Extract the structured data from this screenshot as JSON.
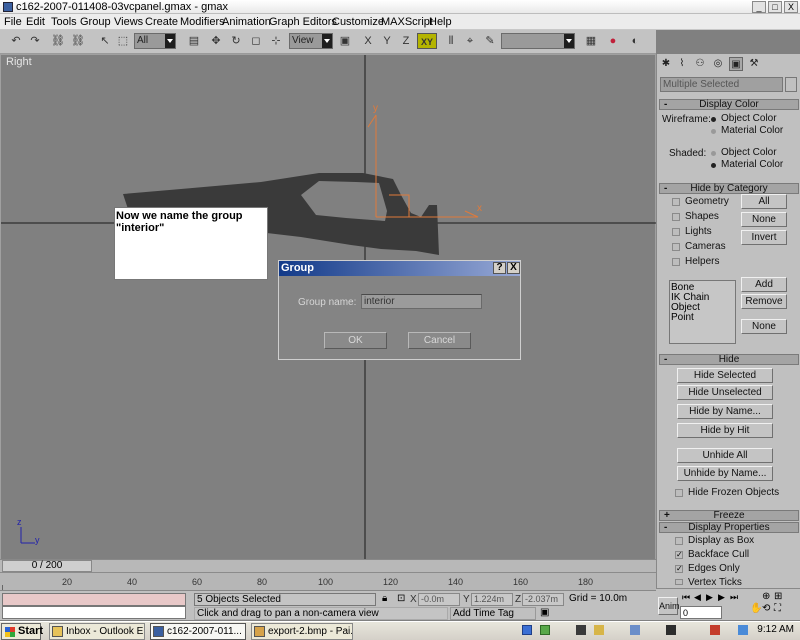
{
  "window": {
    "title": "c162-2007-011408-03vcpanel.gmax - gmax",
    "controls": [
      "_",
      "□",
      "X"
    ]
  },
  "menu": [
    "File",
    "Edit",
    "Tools",
    "Group",
    "Views",
    "Create",
    "Modifiers",
    "Animation",
    "Graph Editors",
    "Customize",
    "MAXScript",
    "Help"
  ],
  "toolbar": {
    "selection_filter": "All",
    "reference_coord": "View",
    "axis_x": "X",
    "axis_y": "Y",
    "axis_z": "Z",
    "axis_xy": "XY"
  },
  "viewport": {
    "label": "Right",
    "annotation": "Now we name the group \"interior\"",
    "gizmo_y": "y",
    "gizmo_x": "x",
    "corner_z": "z",
    "corner_y": "y"
  },
  "dialog": {
    "title": "Group",
    "help_btn": "?",
    "close_btn": "X",
    "name_label": "Group name:",
    "name_value": "interior",
    "ok_label": "OK",
    "cancel_label": "Cancel"
  },
  "cmd_panel": {
    "selection_name": "Multiple Selected",
    "display_color": {
      "header": "Display Color",
      "wireframe_label": "Wireframe:",
      "shaded_label": "Shaded:",
      "object_color": "Object Color",
      "material_color": "Material Color"
    },
    "hide_by_category": {
      "header": "Hide by Category",
      "items": [
        "Geometry",
        "Shapes",
        "Lights",
        "Cameras",
        "Helpers"
      ],
      "all_btn": "All",
      "none_btn": "None",
      "invert_btn": "Invert",
      "list": [
        "Bone",
        "IK Chain Object",
        "Point"
      ],
      "add_btn": "Add",
      "remove_btn": "Remove",
      "none2_btn": "None"
    },
    "hide": {
      "header": "Hide",
      "hide_selected": "Hide Selected",
      "hide_unselected": "Hide Unselected",
      "hide_by_name": "Hide by Name...",
      "hide_by_hit": "Hide by Hit",
      "unhide_all": "Unhide All",
      "unhide_by_name": "Unhide by Name...",
      "hide_frozen": "Hide Frozen Objects"
    },
    "freeze": {
      "header": "Freeze",
      "toggle": "+"
    },
    "display_properties": {
      "header": "Display Properties",
      "toggle": "-",
      "items": [
        {
          "label": "Display as Box",
          "checked": false
        },
        {
          "label": "Backface Cull",
          "checked": true
        },
        {
          "label": "Edges Only",
          "checked": true
        },
        {
          "label": "Vertex Ticks",
          "checked": false
        }
      ]
    }
  },
  "timeline": {
    "slider_label": "0 / 200",
    "ticks": [
      "20",
      "40",
      "60",
      "80",
      "100",
      "120",
      "140",
      "160",
      "180"
    ]
  },
  "status": {
    "selected": "5 Objects Selected",
    "prompt": "Click and drag to pan a non-camera view",
    "x_label": "X",
    "x_value": "-0.0m",
    "y_label": "Y",
    "y_value": "1.224m",
    "z_label": "Z",
    "z_value": "-2.037m",
    "grid": "Grid = 10.0m",
    "add_time_tag": "Add Time Tag",
    "anim": "Anim.",
    "frame": "0"
  },
  "taskbar": {
    "start": "Start",
    "tasks": [
      {
        "label": "Inbox - Outlook E...",
        "active": false
      },
      {
        "label": "c162-2007-011...",
        "active": true
      },
      {
        "label": "export-2.bmp - Pai...",
        "active": false
      }
    ],
    "clock": "9:12 AM"
  },
  "colors": {
    "viewport_bg": "#808080",
    "panel_bg": "#c0c0c0",
    "dialog_title": "#123a89",
    "gizmo": "#e07a3a",
    "track_fill": "#e8c8c8"
  }
}
